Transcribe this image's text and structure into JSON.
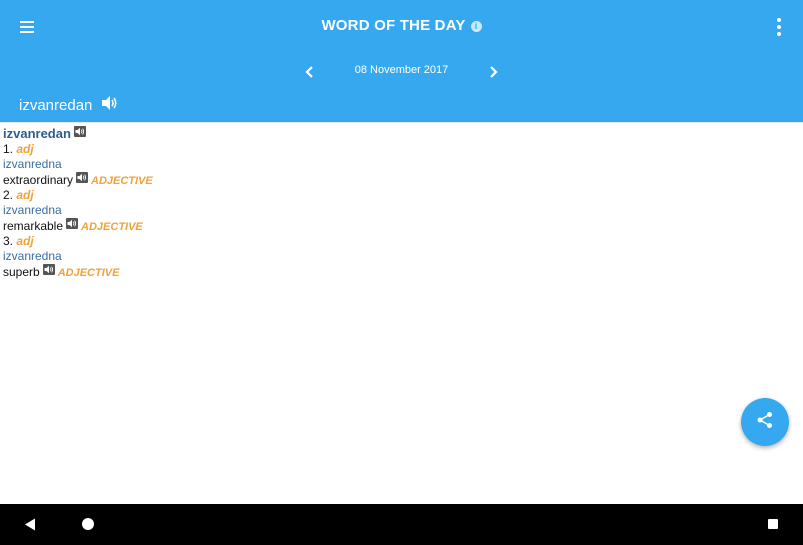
{
  "header": {
    "title": "WORD OF THE DAY",
    "info_glyph": "i",
    "date": "08 November 2017",
    "word": "izvanredan"
  },
  "entry": {
    "word": "izvanredan",
    "senses": [
      {
        "number": "1.",
        "pos_short": "adj",
        "form": "izvanredna",
        "translation": "extraordinary",
        "pos_long": "ADJECTIVE"
      },
      {
        "number": "2.",
        "pos_short": "adj",
        "form": "izvanredna",
        "translation": "remarkable",
        "pos_long": "ADJECTIVE"
      },
      {
        "number": "3.",
        "pos_short": "adj",
        "form": "izvanredna",
        "translation": "superb",
        "pos_long": "ADJECTIVE"
      }
    ]
  },
  "icons": {
    "menu": "menu-icon",
    "info": "info-icon",
    "more": "more-vert-icon",
    "prev": "chevron-left-icon",
    "next": "chevron-right-icon",
    "speaker": "speaker-icon",
    "share": "share-icon",
    "back": "back-triangle-icon",
    "home": "home-circle-icon",
    "recents": "recents-square-icon"
  },
  "colors": {
    "appbar": "#35a8f0",
    "word": "#2d5c8d",
    "form": "#3b6ea0",
    "pos": "#f0a13c",
    "navbar": "#000000"
  }
}
